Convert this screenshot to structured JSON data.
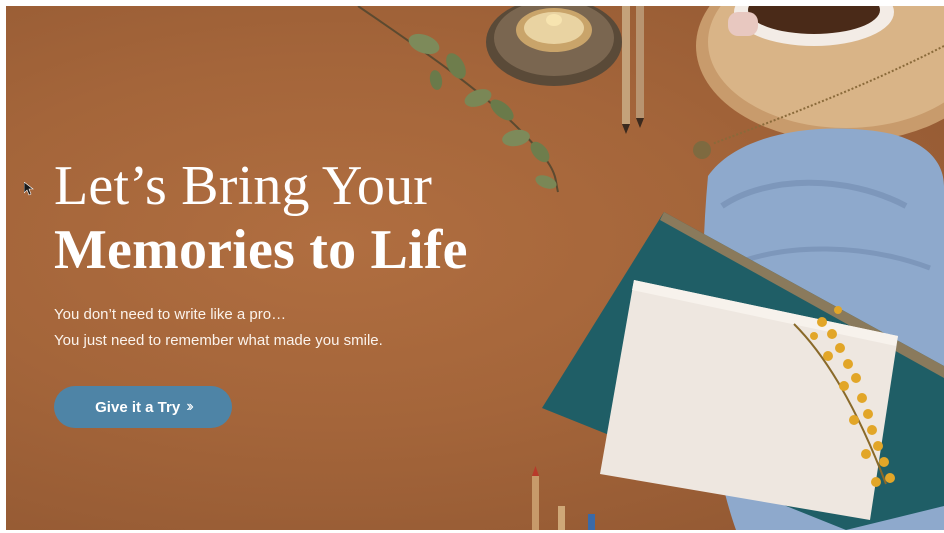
{
  "hero": {
    "headline_line1": "Let’s Bring Your",
    "headline_line2": "Memories to Life",
    "subtext_line1": "You don’t need to write like a pro…",
    "subtext_line2": "You just need to remember what made you smile.",
    "cta_label": "Give it a Try",
    "cta_icon": "double-chevron-right-icon"
  },
  "colors": {
    "background": "#a4653a",
    "cta_background": "#4e84a6",
    "text": "#ffffff"
  }
}
